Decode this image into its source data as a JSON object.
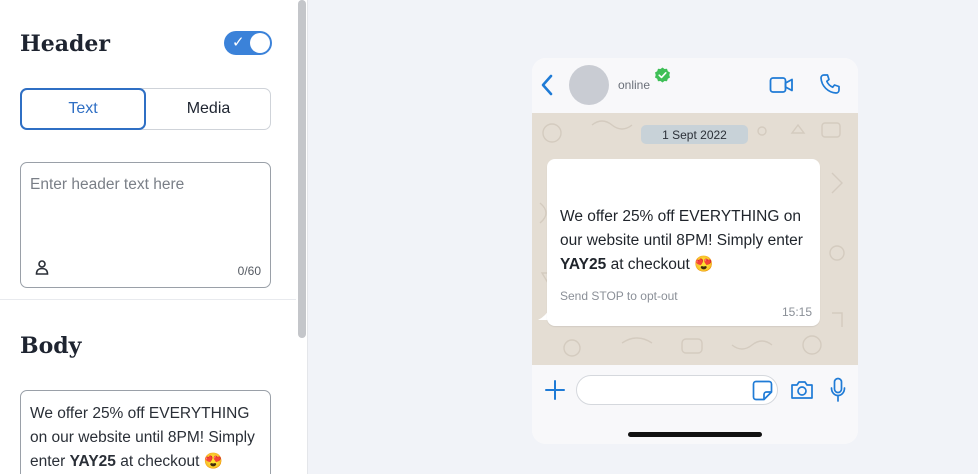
{
  "editor": {
    "header_section": {
      "title": "Header",
      "toggle_on": true,
      "format_options": [
        "Text",
        "Media"
      ],
      "selected_format": "Text",
      "input_placeholder": "Enter header text here",
      "char_counter": "0/60"
    },
    "body_section": {
      "title": "Body",
      "text_before": "We offer 25% off EVERYTHING on our website until 8PM! Simply enter ",
      "text_bold": "YAY25",
      "text_after": " at checkout 😍"
    }
  },
  "preview": {
    "contact_status": "online",
    "date_label": "1 Sept 2022",
    "message": {
      "text_before": "We offer 25% off EVERYTHING on our website until 8PM! Simply enter ",
      "text_bold": "YAY25",
      "text_after": " at checkout 😍",
      "footer": "Send STOP to opt-out",
      "time": "15:15"
    }
  },
  "icons": {
    "toggle": "check-icon",
    "header_input": "person-icon",
    "back": "chevron-left-icon",
    "verified": "verified-badge-icon",
    "video": "video-icon",
    "call": "phone-icon",
    "attach": "plus-icon",
    "sticker": "sticker-icon",
    "camera": "camera-icon",
    "mic": "mic-icon"
  },
  "colors": {
    "accent": "#3b82d9",
    "segment_active": "#2f6fc4",
    "whatsapp_blue": "#1f7bd6",
    "verified_green": "#3fbf57",
    "chat_background": "#e4ddd3",
    "page_background": "#f1f3f8"
  }
}
